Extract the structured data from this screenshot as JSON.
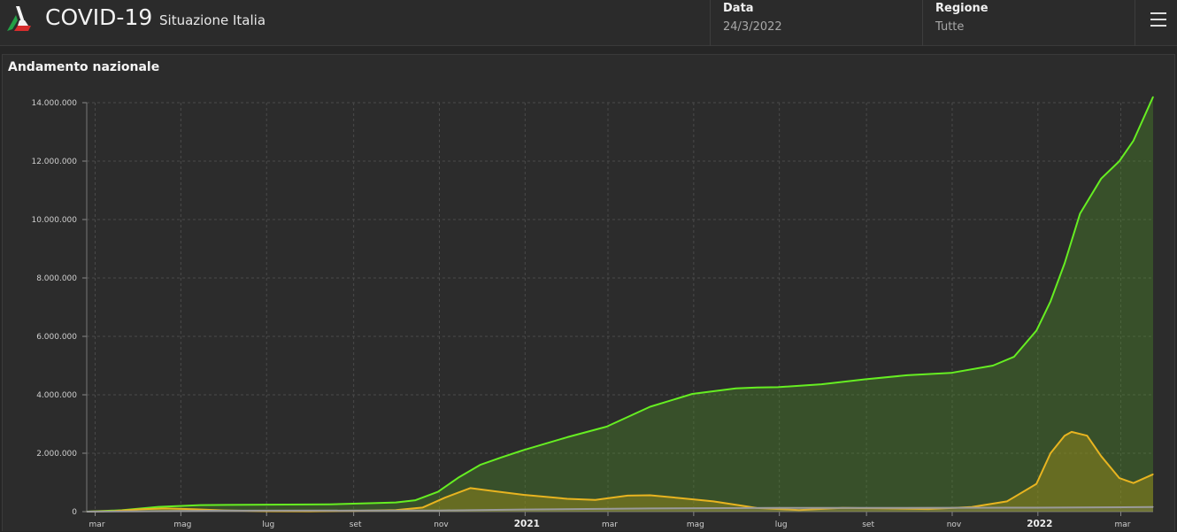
{
  "header": {
    "title": "COVID-19",
    "subtitle": "Situazione Italia",
    "date_label": "Data",
    "date_value": "24/3/2022",
    "region_label": "Regione",
    "region_value": "Tutte",
    "menu_icon": "hamburger-menu-icon"
  },
  "panel": {
    "title": "Andamento nazionale"
  },
  "colors": {
    "total": "#66ee22",
    "active": "#e8b420",
    "other": "#9a9a9a",
    "grid": "#4a4a4a"
  },
  "chart_data": {
    "type": "area",
    "title": "Andamento nazionale",
    "xlabel": "",
    "ylabel": "",
    "ylim": [
      0,
      14000000
    ],
    "yticks": [
      0,
      2000000,
      4000000,
      6000000,
      8000000,
      10000000,
      12000000,
      14000000
    ],
    "ytick_labels": [
      "0",
      "2.000.000",
      "4.000.000",
      "6.000.000",
      "8.000.000",
      "10.000.000",
      "12.000.000",
      "14.000.000"
    ],
    "xlim": [
      "2020-02-24",
      "2022-03-24"
    ],
    "xticks": [
      {
        "date": "2020-03-01",
        "label": "mar",
        "year": false
      },
      {
        "date": "2020-05-01",
        "label": "mag",
        "year": false
      },
      {
        "date": "2020-07-01",
        "label": "lug",
        "year": false
      },
      {
        "date": "2020-09-01",
        "label": "set",
        "year": false
      },
      {
        "date": "2020-11-01",
        "label": "nov",
        "year": false
      },
      {
        "date": "2021-01-01",
        "label": "2021",
        "year": true
      },
      {
        "date": "2021-03-01",
        "label": "mar",
        "year": false
      },
      {
        "date": "2021-05-01",
        "label": "mag",
        "year": false
      },
      {
        "date": "2021-07-01",
        "label": "lug",
        "year": false
      },
      {
        "date": "2021-09-01",
        "label": "set",
        "year": false
      },
      {
        "date": "2021-11-01",
        "label": "nov",
        "year": false
      },
      {
        "date": "2022-01-01",
        "label": "2022",
        "year": true
      },
      {
        "date": "2022-03-01",
        "label": "mar",
        "year": false
      }
    ],
    "grid": true,
    "series": [
      {
        "key": "total",
        "color": "#66ee22",
        "points": [
          [
            "2020-02-24",
            0
          ],
          [
            "2020-03-20",
            50000
          ],
          [
            "2020-04-15",
            165000
          ],
          [
            "2020-05-15",
            225000
          ],
          [
            "2020-06-15",
            237000
          ],
          [
            "2020-07-15",
            243000
          ],
          [
            "2020-08-15",
            253000
          ],
          [
            "2020-09-15",
            290000
          ],
          [
            "2020-10-01",
            315000
          ],
          [
            "2020-10-15",
            390000
          ],
          [
            "2020-10-31",
            680000
          ],
          [
            "2020-11-15",
            1180000
          ],
          [
            "2020-11-30",
            1600000
          ],
          [
            "2020-12-15",
            1855000
          ],
          [
            "2020-12-31",
            2110000
          ],
          [
            "2021-01-31",
            2550000
          ],
          [
            "2021-02-28",
            2910000
          ],
          [
            "2021-03-31",
            3590000
          ],
          [
            "2021-04-30",
            4030000
          ],
          [
            "2021-05-31",
            4220000
          ],
          [
            "2021-06-15",
            4250000
          ],
          [
            "2021-06-30",
            4260000
          ],
          [
            "2021-07-31",
            4360000
          ],
          [
            "2021-08-31",
            4530000
          ],
          [
            "2021-09-30",
            4670000
          ],
          [
            "2021-10-31",
            4750000
          ],
          [
            "2021-11-30",
            5000000
          ],
          [
            "2021-12-15",
            5300000
          ],
          [
            "2021-12-31",
            6200000
          ],
          [
            "2022-01-10",
            7200000
          ],
          [
            "2022-01-20",
            8500000
          ],
          [
            "2022-01-31",
            10200000
          ],
          [
            "2022-02-15",
            11400000
          ],
          [
            "2022-02-28",
            12000000
          ],
          [
            "2022-03-10",
            12700000
          ],
          [
            "2022-03-24",
            14200000
          ]
        ]
      },
      {
        "key": "active",
        "color": "#e8b420",
        "points": [
          [
            "2020-02-24",
            0
          ],
          [
            "2020-03-15",
            20000
          ],
          [
            "2020-04-01",
            80000
          ],
          [
            "2020-04-20",
            108000
          ],
          [
            "2020-05-10",
            85000
          ],
          [
            "2020-06-01",
            42000
          ],
          [
            "2020-07-01",
            15000
          ],
          [
            "2020-08-01",
            12500
          ],
          [
            "2020-09-01",
            26000
          ],
          [
            "2020-10-01",
            52000
          ],
          [
            "2020-10-20",
            140000
          ],
          [
            "2020-11-05",
            480000
          ],
          [
            "2020-11-23",
            805000
          ],
          [
            "2020-12-10",
            700000
          ],
          [
            "2020-12-31",
            575000
          ],
          [
            "2021-01-31",
            440000
          ],
          [
            "2021-02-20",
            400000
          ],
          [
            "2021-03-15",
            550000
          ],
          [
            "2021-03-31",
            560000
          ],
          [
            "2021-04-20",
            470000
          ],
          [
            "2021-05-15",
            350000
          ],
          [
            "2021-06-15",
            125000
          ],
          [
            "2021-07-15",
            55000
          ],
          [
            "2021-08-15",
            130000
          ],
          [
            "2021-09-15",
            110000
          ],
          [
            "2021-10-15",
            88000
          ],
          [
            "2021-11-15",
            160000
          ],
          [
            "2021-12-10",
            350000
          ],
          [
            "2021-12-31",
            950000
          ],
          [
            "2022-01-10",
            2000000
          ],
          [
            "2022-01-20",
            2600000
          ],
          [
            "2022-01-25",
            2730000
          ],
          [
            "2022-02-05",
            2600000
          ],
          [
            "2022-02-15",
            1900000
          ],
          [
            "2022-02-28",
            1150000
          ],
          [
            "2022-03-10",
            980000
          ],
          [
            "2022-03-24",
            1280000
          ]
        ]
      },
      {
        "key": "other",
        "color": "#9a9a9a",
        "points": [
          [
            "2020-02-24",
            0
          ],
          [
            "2020-04-01",
            12000
          ],
          [
            "2020-06-01",
            33000
          ],
          [
            "2020-09-01",
            35500
          ],
          [
            "2020-11-01",
            40000
          ],
          [
            "2020-12-31",
            74000
          ],
          [
            "2021-03-31",
            110000
          ],
          [
            "2021-06-30",
            127000
          ],
          [
            "2021-09-30",
            131000
          ],
          [
            "2021-12-31",
            137000
          ],
          [
            "2022-03-24",
            158000
          ]
        ]
      }
    ]
  }
}
